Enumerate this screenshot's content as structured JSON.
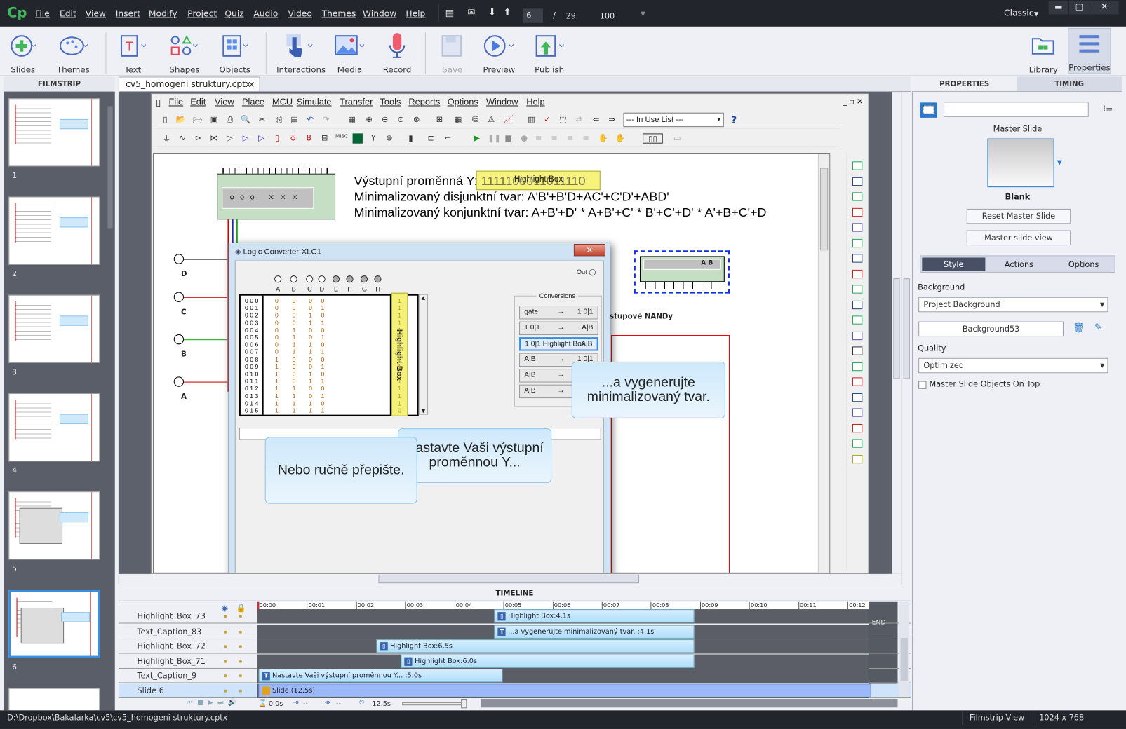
{
  "app": {
    "logo": "Cp",
    "workspace": "Classic",
    "page_current": "6",
    "page_total": "29",
    "zoom": "100"
  },
  "menu": [
    "File",
    "Edit",
    "View",
    "Insert",
    "Modify",
    "Project",
    "Quiz",
    "Audio",
    "Video",
    "Themes",
    "Window",
    "Help"
  ],
  "toolbar": {
    "slides": "Slides",
    "themes": "Themes",
    "text": "Text",
    "shapes": "Shapes",
    "objects": "Objects",
    "interactions": "Interactions",
    "media": "Media",
    "record": "Record",
    "save": "Save",
    "preview": "Preview",
    "publish": "Publish",
    "library": "Library",
    "properties": "Properties"
  },
  "filmstrip": {
    "title": "FILMSTRIP",
    "slides": [
      "1",
      "2",
      "3",
      "4",
      "5",
      "6"
    ],
    "selected": "6"
  },
  "doc_tab": {
    "label": "cv5_homogeni struktury.cptx",
    "close": "×"
  },
  "multisim": {
    "menu": [
      "File",
      "Edit",
      "View",
      "Place",
      "MCU",
      "Simulate",
      "Transfer",
      "Tools",
      "Reports",
      "Options",
      "Window",
      "Help"
    ],
    "in_use_list": "--- In Use List ---",
    "line1": "Výstupní proměnná Y:",
    "y_value": "1111100011011110",
    "highlight_label": "Highlight Box",
    "line2": "Minimalizovaný disjunktní tvar:   A'B'+B'D+AC'+C'D'+ABD'",
    "line3": "Minimalizovaný konjunktní tvar:  A+B'+D' * A+B'+C' * B'+C'+D' * A'+B+C'+D",
    "inputs": [
      "D",
      "C",
      "B",
      "A"
    ],
    "nand_text": "stupové NANDy",
    "chip2_label": "A B"
  },
  "dialog": {
    "title": "Logic Converter-XLC1",
    "close": "✕",
    "out_label": "Out",
    "columns": [
      "A",
      "B",
      "C",
      "D",
      "E",
      "F",
      "G",
      "H"
    ],
    "rows": [
      [
        "0 0 0",
        "0",
        "0",
        "0",
        "0",
        "1"
      ],
      [
        "0 0 1",
        "0",
        "0",
        "0",
        "1",
        "1"
      ],
      [
        "0 0 2",
        "0",
        "0",
        "1",
        "0",
        "1"
      ],
      [
        "0 0 3",
        "0",
        "0",
        "1",
        "1",
        "1"
      ],
      [
        "0 0 4",
        "0",
        "1",
        "0",
        "0",
        "1"
      ],
      [
        "0 0 5",
        "0",
        "1",
        "0",
        "1",
        "1"
      ],
      [
        "0 0 6",
        "0",
        "1",
        "1",
        "0",
        "1"
      ],
      [
        "0 0 7",
        "0",
        "1",
        "1",
        "1",
        "1"
      ],
      [
        "0 0 8",
        "1",
        "0",
        "0",
        "0",
        "1"
      ],
      [
        "0 0 9",
        "1",
        "0",
        "0",
        "1",
        "1"
      ],
      [
        "0 1 0",
        "1",
        "0",
        "1",
        "0",
        "1"
      ],
      [
        "0 1 1",
        "1",
        "0",
        "1",
        "1",
        "1"
      ],
      [
        "0 1 2",
        "1",
        "1",
        "0",
        "0",
        "1"
      ],
      [
        "0 1 3",
        "1",
        "1",
        "0",
        "1",
        "1"
      ],
      [
        "0 1 4",
        "1",
        "1",
        "1",
        "0",
        "1"
      ],
      [
        "0 1 5",
        "1",
        "1",
        "1",
        "1",
        "0"
      ]
    ],
    "output_highlight_label": "Highlight Box",
    "conversions_title": "Conversions",
    "conversions": [
      [
        "gate",
        "→",
        "1 0|1"
      ],
      [
        "1 0|1",
        "→",
        "A|B"
      ],
      [
        "1 0|1 Highlight Box",
        "→",
        "A|B"
      ],
      [
        "A|B",
        "→",
        "1 0|1"
      ],
      [
        "A|B",
        "→",
        ""
      ],
      [
        "A|B",
        "→",
        ""
      ]
    ],
    "conv_highlight_label": "Highlight Box"
  },
  "captions": {
    "c1": "...a vygenerujte minimalizovaný tvar.",
    "c2": "Nastavte Vaši výstupní proměnnou Y...",
    "c3": "Nebo ručně přepište."
  },
  "timeline": {
    "title": "TIMELINE",
    "ticks": [
      "00:00",
      "00:01",
      "00:02",
      "00:03",
      "00:04",
      "00:05",
      "00:06",
      "00:07",
      "00:08",
      "00:09",
      "00:10",
      "00:11",
      "00:12"
    ],
    "end_label": "END",
    "items": [
      {
        "name": "Highlight_Box_73",
        "label": "Highlight Box:4.1s",
        "icon": "highlight-box",
        "start": 4.8,
        "duration": 4.1
      },
      {
        "name": "Text_Caption_83",
        "label": "...a vygenerujte minimalizovaný tvar. :4.1s",
        "icon": "text-caption",
        "start": 4.8,
        "duration": 4.1
      },
      {
        "name": "Highlight_Box_72",
        "label": "Highlight Box:6.5s",
        "icon": "highlight-box",
        "start": 2.4,
        "duration": 6.5
      },
      {
        "name": "Highlight_Box_71",
        "label": "Highlight Box:6.0s",
        "icon": "highlight-box",
        "start": 2.9,
        "duration": 6.0
      },
      {
        "name": "Text_Caption_9",
        "label": "Nastavte Vaši výstupní proměnnou Y... :5.0s",
        "icon": "text-caption",
        "start": 0,
        "duration": 5.0
      },
      {
        "name": "Slide 6",
        "label": "Slide (12.5s)",
        "icon": "slide",
        "start": 0,
        "duration": 12.5
      }
    ],
    "footer": {
      "current": "0.0s",
      "in": "--",
      "out": "--",
      "duration": "12.5s"
    }
  },
  "properties": {
    "tabs": [
      "PROPERTIES",
      "TIMING"
    ],
    "master_slide_label": "Master Slide",
    "master_name": "Blank",
    "reset_btn": "Reset Master Slide",
    "view_btn": "Master slide view",
    "subtabs": [
      "Style",
      "Actions",
      "Options"
    ],
    "background_label": "Background",
    "background_value": "Project Background",
    "background_image": "Background53",
    "quality_label": "Quality",
    "quality_value": "Optimized",
    "checkbox_label": "Master Slide Objects On Top",
    "checkbox_checked": false
  },
  "status": {
    "path": "D:\\Dropbox\\Bakalarka\\cv5\\cv5_homogeni struktury.cptx",
    "view": "Filmstrip View",
    "resolution": "1024 x 768"
  },
  "colors": {
    "accent": "#3b8de0",
    "highlight": "#f5f07a",
    "caption": "#cfe9fb",
    "timeline_bar": "#b0defa",
    "slide_bar": "#9bb8f8"
  }
}
